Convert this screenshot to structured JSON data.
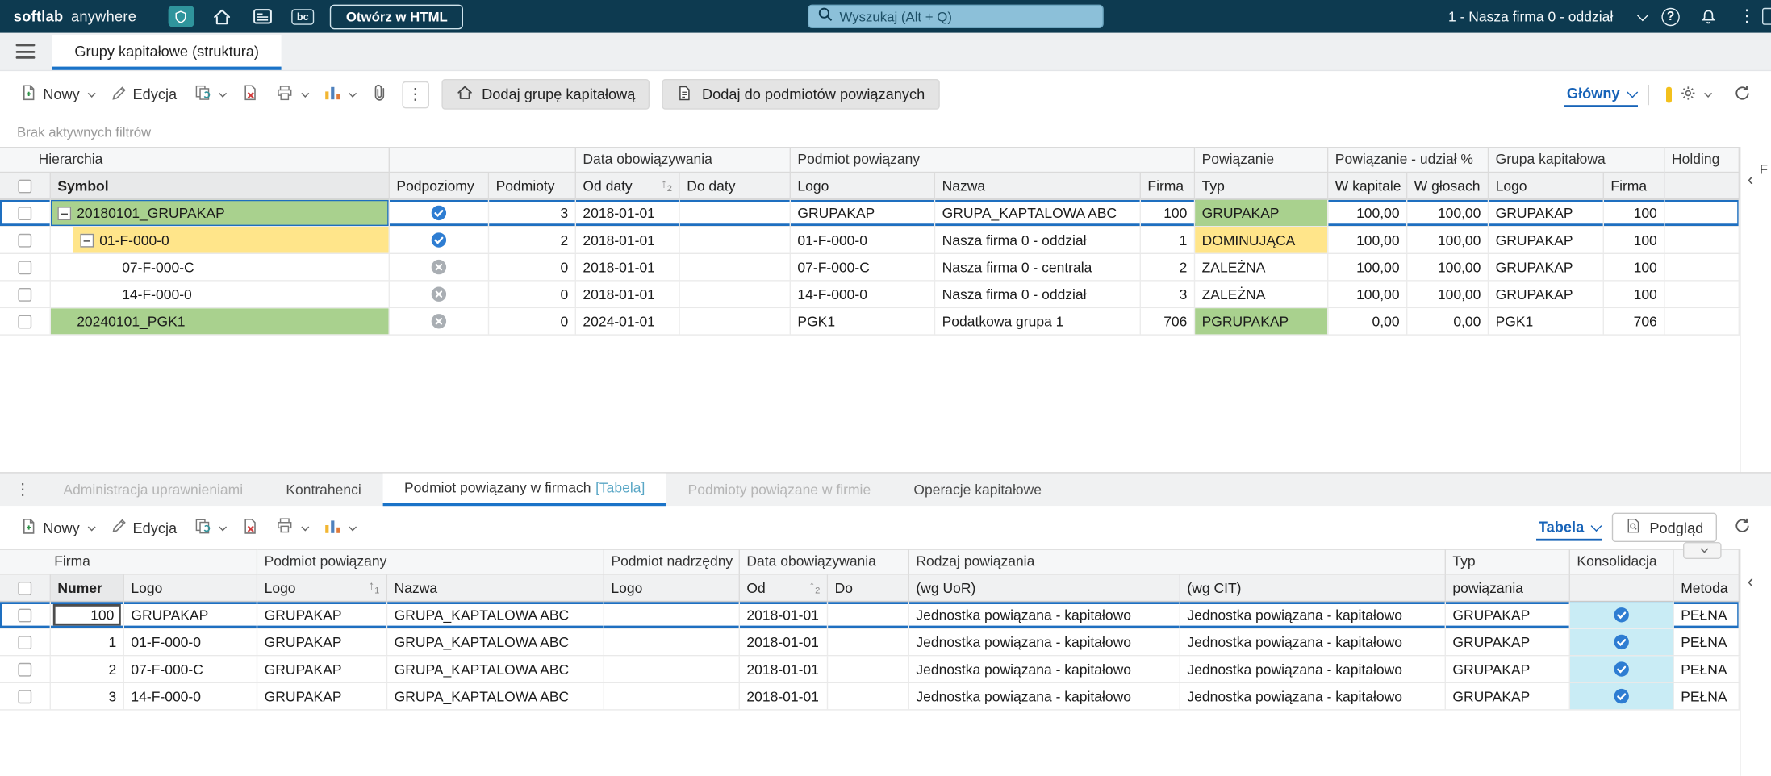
{
  "colors": {
    "topbar_bg": "#0d3a50",
    "accent_blue": "#1e6fc0",
    "link_blue": "#1763b8",
    "tab_underline": "#1a73c8",
    "row_green": "#a9d18e",
    "row_yellow": "#ffe58a",
    "cell_cyan": "#c9ecf5",
    "check_blue": "#2e7dd2",
    "cross_gray": "#a9aeb3",
    "search_bg": "#8cc0d9"
  },
  "icons": {
    "dots_vertical": "⋮",
    "collapse_left": "‹",
    "sort_asc": "↑",
    "help": "?"
  },
  "topbar": {
    "brand_primary": "softlab",
    "brand_secondary": "anywhere",
    "bc_label": "bc",
    "open_html": "Otwórz w HTML",
    "search_placeholder": "Wyszukaj (Alt + Q)",
    "context": "1 - Nasza firma 0 - oddział"
  },
  "workspace_tab": "Grupy kapitałowe (struktura)",
  "toolbar_main": {
    "new": "Nowy",
    "edit": "Edycja",
    "add_group": "Dodaj grupę kapitałową",
    "add_related": "Dodaj do podmiotów powiązanych",
    "view": "Główny"
  },
  "filters_note": "Brak aktywnych filtrów",
  "panel_label": "F",
  "table1": {
    "groups": [
      {
        "label": "Hierarchia"
      },
      {
        "label": ""
      },
      {
        "label": "Data obowiązywania"
      },
      {
        "label": "Podmiot powiązany"
      },
      {
        "label": "Powiązanie"
      },
      {
        "label": "Powiązanie - udział %"
      },
      {
        "label": "Grupa kapitałowa"
      },
      {
        "label": "Holding"
      }
    ],
    "columns": [
      {
        "label": ""
      },
      {
        "label": "Symbol"
      },
      {
        "label": "Podpoziomy"
      },
      {
        "label": "Podmioty"
      },
      {
        "label": "Od daty",
        "sort": "2"
      },
      {
        "label": "Do daty"
      },
      {
        "label": "Logo"
      },
      {
        "label": "Nazwa"
      },
      {
        "label": "Firma"
      },
      {
        "label": "Typ"
      },
      {
        "label": "W kapitale"
      },
      {
        "label": "W głosach"
      },
      {
        "label": "Logo"
      },
      {
        "label": "Firma"
      },
      {
        "label": ""
      }
    ],
    "rows": [
      {
        "symbol": "20180101_GRUPAKAP",
        "indent": 0,
        "expander": true,
        "symbol_hl": "green",
        "selected": true,
        "podpoziomy": "yes",
        "podmioty": "3",
        "od": "2018-01-01",
        "do": "",
        "logo": "GRUPAKAP",
        "nazwa": "GRUPA_KAPTALOWA ABC",
        "firma": "100",
        "typ": "GRUPAKAP",
        "typ_hl": "green",
        "w_kapitale": "100,00",
        "w_glosach": "100,00",
        "gk_logo": "GRUPAKAP",
        "gk_firma": "100",
        "holding": ""
      },
      {
        "symbol": "01-F-000-0",
        "indent": 1,
        "expander": true,
        "symbol_hl": "yellow",
        "selected": false,
        "podpoziomy": "yes",
        "podmioty": "2",
        "od": "2018-01-01",
        "do": "",
        "logo": "01-F-000-0",
        "nazwa": "Nasza firma 0 - oddział",
        "firma": "1",
        "typ": "DOMINUJĄCA",
        "typ_hl": "yellow",
        "w_kapitale": "100,00",
        "w_glosach": "100,00",
        "gk_logo": "GRUPAKAP",
        "gk_firma": "100",
        "holding": ""
      },
      {
        "symbol": "07-F-000-C",
        "indent": 2,
        "expander": false,
        "symbol_hl": null,
        "selected": false,
        "podpoziomy": "no",
        "podmioty": "0",
        "od": "2018-01-01",
        "do": "",
        "logo": "07-F-000-C",
        "nazwa": "Nasza firma 0 - centrala",
        "firma": "2",
        "typ": "ZALEŻNA",
        "typ_hl": null,
        "w_kapitale": "100,00",
        "w_glosach": "100,00",
        "gk_logo": "GRUPAKAP",
        "gk_firma": "100",
        "holding": ""
      },
      {
        "symbol": "14-F-000-0",
        "indent": 2,
        "expander": false,
        "symbol_hl": null,
        "selected": false,
        "podpoziomy": "no",
        "podmioty": "0",
        "od": "2018-01-01",
        "do": "",
        "logo": "14-F-000-0",
        "nazwa": "Nasza firma 0 - oddział",
        "firma": "3",
        "typ": "ZALEŻNA",
        "typ_hl": null,
        "w_kapitale": "100,00",
        "w_glosach": "100,00",
        "gk_logo": "GRUPAKAP",
        "gk_firma": "100",
        "holding": ""
      },
      {
        "symbol": "20240101_PGK1",
        "indent": 0,
        "expander": false,
        "symbol_hl": "green",
        "selected": false,
        "podpoziomy": "no",
        "podmioty": "0",
        "od": "2024-01-01",
        "do": "",
        "logo": "PGK1",
        "nazwa": "Podatkowa grupa 1",
        "firma": "706",
        "typ": "PGRUPAKAP",
        "typ_hl": "green",
        "w_kapitale": "0,00",
        "w_glosach": "0,00",
        "gk_logo": "PGK1",
        "gk_firma": "706",
        "holding": ""
      }
    ]
  },
  "bottom_tabs": [
    {
      "label": "Administracja uprawnieniami",
      "state": "disabled"
    },
    {
      "label": "Kontrahenci",
      "state": "normal"
    },
    {
      "label": "Podmiot powiązany w firmach",
      "suffix": "[Tabela]",
      "state": "active"
    },
    {
      "label": "Podmioty powiązane w firmie",
      "state": "disabled"
    },
    {
      "label": "Operacje kapitałowe",
      "state": "normal"
    }
  ],
  "toolbar_bottom": {
    "new": "Nowy",
    "edit": "Edycja",
    "view": "Tabela",
    "preview": "Podgląd"
  },
  "table2": {
    "groups": [
      {
        "label": "Firma"
      },
      {
        "label": "Podmiot powiązany"
      },
      {
        "label": "Podmiot nadrzędny"
      },
      {
        "label": "Data obowiązywania"
      },
      {
        "label": "Rodzaj powiązania"
      },
      {
        "label": "Typ"
      },
      {
        "label": "Konsolidacja"
      },
      {
        "label": ""
      }
    ],
    "columns": [
      {
        "label": ""
      },
      {
        "label": "Numer"
      },
      {
        "label": "Logo"
      },
      {
        "label": "Logo",
        "sort": "1"
      },
      {
        "label": "Nazwa"
      },
      {
        "label": "Logo"
      },
      {
        "label": "Od",
        "sort": "2"
      },
      {
        "label": "Do"
      },
      {
        "label": "(wg UoR)"
      },
      {
        "label": "(wg CIT)"
      },
      {
        "label": "powiązania"
      },
      {
        "label": ""
      },
      {
        "label": "Metoda"
      }
    ],
    "rows": [
      {
        "numer": "100",
        "logo": "GRUPAKAP",
        "pp_logo": "GRUPAKAP",
        "nazwa": "GRUPA_KAPTALOWA ABC",
        "pn_logo": "",
        "od": "2018-01-01",
        "do": "",
        "wg_uor": "Jednostka powiązana - kapitałowo",
        "wg_cit": "Jednostka powiązana - kapitałowo",
        "typ": "GRUPAKAP",
        "konsolidacja": true,
        "metoda": "PEŁNA",
        "selected": true
      },
      {
        "numer": "1",
        "logo": "01-F-000-0",
        "pp_logo": "GRUPAKAP",
        "nazwa": "GRUPA_KAPTALOWA ABC",
        "pn_logo": "",
        "od": "2018-01-01",
        "do": "",
        "wg_uor": "Jednostka powiązana - kapitałowo",
        "wg_cit": "Jednostka powiązana - kapitałowo",
        "typ": "GRUPAKAP",
        "konsolidacja": true,
        "metoda": "PEŁNA",
        "selected": false
      },
      {
        "numer": "2",
        "logo": "07-F-000-C",
        "pp_logo": "GRUPAKAP",
        "nazwa": "GRUPA_KAPTALOWA ABC",
        "pn_logo": "",
        "od": "2018-01-01",
        "do": "",
        "wg_uor": "Jednostka powiązana - kapitałowo",
        "wg_cit": "Jednostka powiązana - kapitałowo",
        "typ": "GRUPAKAP",
        "konsolidacja": true,
        "metoda": "PEŁNA",
        "selected": false
      },
      {
        "numer": "3",
        "logo": "14-F-000-0",
        "pp_logo": "GRUPAKAP",
        "nazwa": "GRUPA_KAPTALOWA ABC",
        "pn_logo": "",
        "od": "2018-01-01",
        "do": "",
        "wg_uor": "Jednostka powiązana - kapitałowo",
        "wg_cit": "Jednostka powiązana - kapitałowo",
        "typ": "GRUPAKAP",
        "konsolidacja": true,
        "metoda": "PEŁNA",
        "selected": false
      }
    ]
  }
}
